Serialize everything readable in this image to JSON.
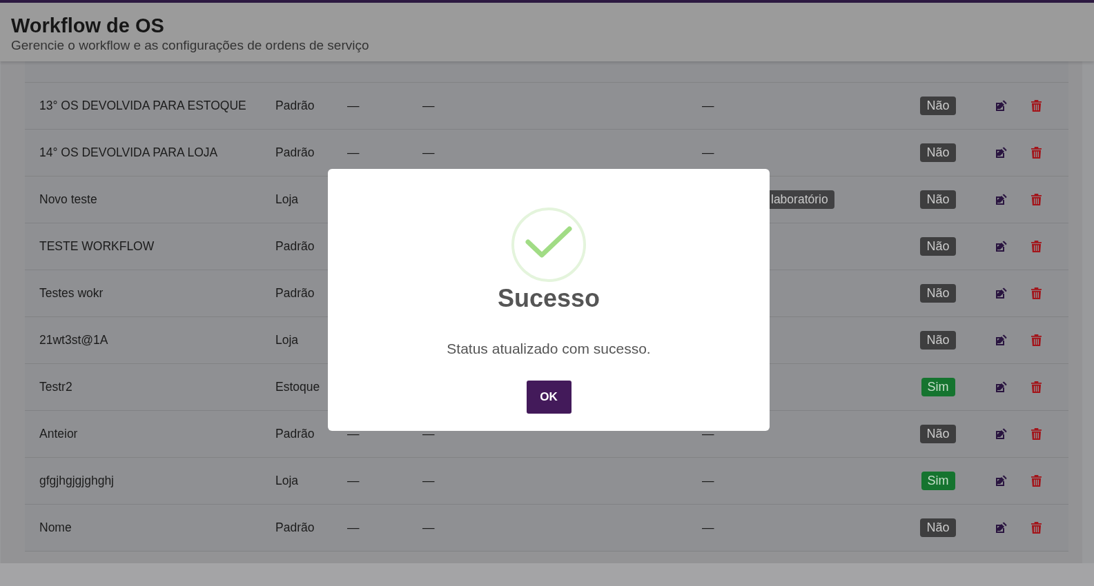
{
  "header": {
    "title": "Workflow de OS",
    "subtitle": "Gerencie o workflow e as configurações de ordens de serviço"
  },
  "table": {
    "rows": [
      {
        "name": "13° OS DEVOLVIDA PARA ESTOQUE",
        "type": "Padrão",
        "column_3": "—",
        "column_4": "—",
        "column_5": "—",
        "status": "Não",
        "active": false
      },
      {
        "name": "14° OS DEVOLVIDA PARA LOJA",
        "type": "Padrão",
        "column_3": "—",
        "column_4": "—",
        "column_5": "—",
        "status": "Não",
        "active": false
      },
      {
        "name": "Novo teste",
        "type": "Loja",
        "tag": "laboratório",
        "status": "Não",
        "active": false
      },
      {
        "name": "TESTE WORKFLOW",
        "type": "Padrão",
        "status": "Não",
        "active": false
      },
      {
        "name": "Testes wokr",
        "type": "Padrão",
        "status": "Não",
        "active": false
      },
      {
        "name": "21wt3st@1A",
        "type": "Loja",
        "status": "Não",
        "active": false
      },
      {
        "name": "Testr2",
        "type": "Estoque",
        "status": "Sim",
        "active": true
      },
      {
        "name": "Anteior",
        "type": "Padrão",
        "column_3": "—",
        "column_4": "—",
        "column_5": "—",
        "status": "Não",
        "active": false
      },
      {
        "name": "gfgjhgjgjghghj",
        "type": "Loja",
        "column_3": "—",
        "column_4": "—",
        "column_5": "—",
        "status": "Sim",
        "active": true
      },
      {
        "name": "Nome",
        "type": "Padrão",
        "column_3": "—",
        "column_4": "—",
        "column_5": "—",
        "status": "Não",
        "active": false
      }
    ]
  },
  "dialog": {
    "title": "Sucesso",
    "message": "Status atualizado com sucesso.",
    "button": "OK"
  }
}
